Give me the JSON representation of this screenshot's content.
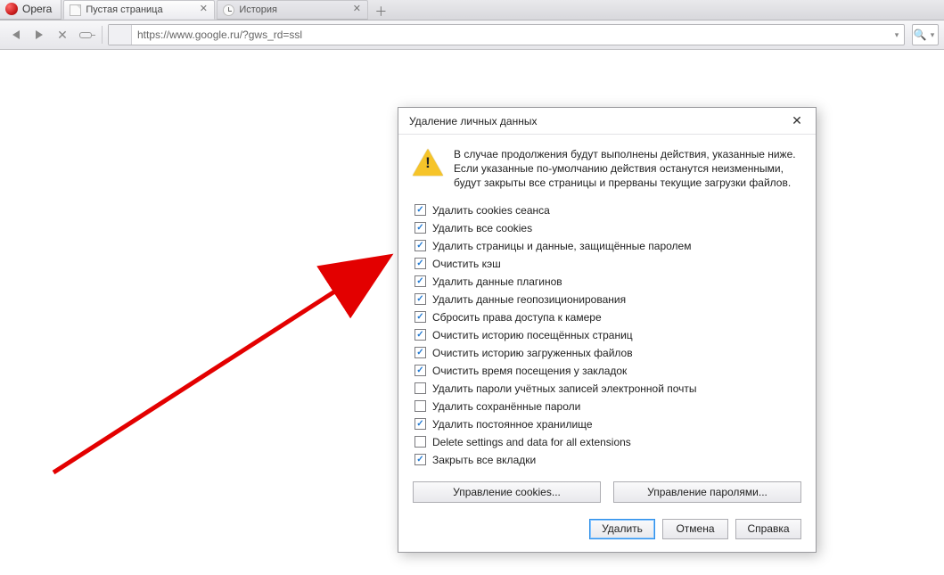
{
  "app": {
    "name": "Opera"
  },
  "tabs": [
    {
      "title": "Пустая страница"
    },
    {
      "title": "История"
    }
  ],
  "toolbar": {
    "url": "https://www.google.ru/?gws_rd=ssl"
  },
  "dialog": {
    "title": "Удаление личных данных",
    "warning": "В случае продолжения будут выполнены действия, указанные ниже. Если указанные по-умолчанию действия останутся неизменными, будут закрыты все страницы и прерваны текущие загрузки файлов.",
    "options": [
      {
        "checked": true,
        "label": "Удалить cookies сеанса"
      },
      {
        "checked": true,
        "label": "Удалить все cookies"
      },
      {
        "checked": true,
        "label": "Удалить страницы и данные, защищённые паролем"
      },
      {
        "checked": true,
        "label": "Очистить кэш"
      },
      {
        "checked": true,
        "label": "Удалить данные плагинов"
      },
      {
        "checked": true,
        "label": "Удалить данные геопозиционирования"
      },
      {
        "checked": true,
        "label": "Сбросить права доступа к камере"
      },
      {
        "checked": true,
        "label": "Очистить историю посещённых страниц"
      },
      {
        "checked": true,
        "label": "Очистить историю загруженных файлов"
      },
      {
        "checked": true,
        "label": "Очистить время посещения у закладок"
      },
      {
        "checked": false,
        "label": "Удалить пароли учётных записей электронной почты"
      },
      {
        "checked": false,
        "label": "Удалить сохранённые пароли"
      },
      {
        "checked": true,
        "label": "Удалить постоянное хранилище"
      },
      {
        "checked": false,
        "label": "Delete settings and data for all extensions"
      },
      {
        "checked": true,
        "label": "Закрыть все вкладки"
      }
    ],
    "manage_cookies": "Управление cookies...",
    "manage_passwords": "Управление паролями...",
    "buttons": {
      "delete": "Удалить",
      "cancel": "Отмена",
      "help": "Справка"
    }
  }
}
